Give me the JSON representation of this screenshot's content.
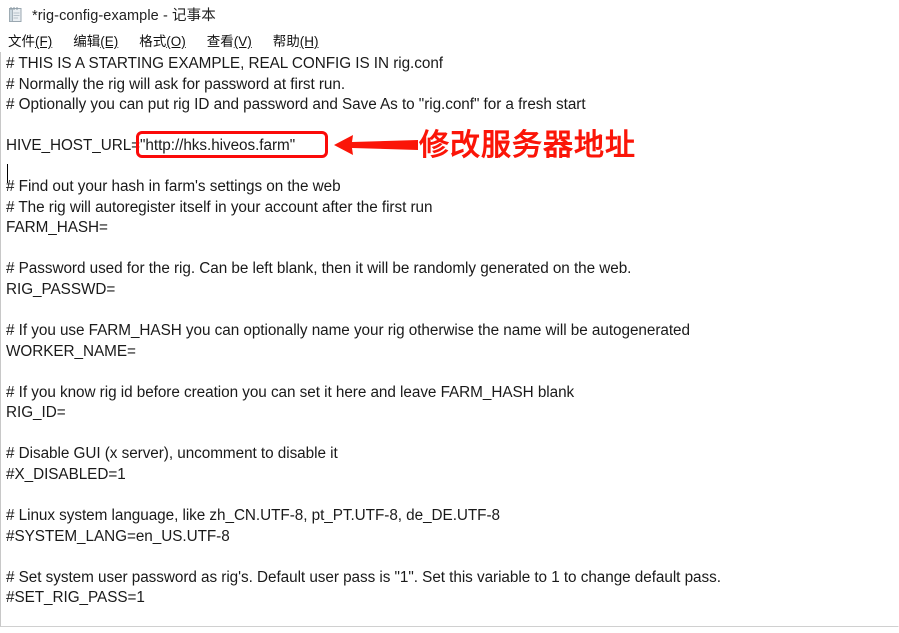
{
  "window": {
    "title": "*rig-config-example - 记事本",
    "icon": "notepad-icon"
  },
  "menubar": {
    "items": [
      {
        "label": "文件",
        "accel": "(F)",
        "name": "menu-file"
      },
      {
        "label": "编辑",
        "accel": "(E)",
        "name": "menu-edit"
      },
      {
        "label": "格式",
        "accel": "(O)",
        "name": "menu-format"
      },
      {
        "label": "查看",
        "accel": "(V)",
        "name": "menu-view"
      },
      {
        "label": "帮助",
        "accel": "(H)",
        "name": "menu-help"
      }
    ]
  },
  "editor": {
    "lines": [
      "# THIS IS A STARTING EXAMPLE, REAL CONFIG IS IN rig.conf",
      "# Normally the rig will ask for password at first run.",
      "# Optionally you can put rig ID and password and Save As to \"rig.conf\" for a fresh start",
      "",
      "HIVE_HOST_URL=\"http://hks.hiveos.farm\"",
      "",
      "# Find out your hash in farm's settings on the web",
      "# The rig will autoregister itself in your account after the first run",
      "FARM_HASH=",
      "",
      "# Password used for the rig. Can be left blank, then it will be randomly generated on the web.",
      "RIG_PASSWD=",
      "",
      "# If you use FARM_HASH you can optionally name your rig otherwise the name will be autogenerated",
      "WORKER_NAME=",
      "",
      "# If you know rig id before creation you can set it here and leave FARM_HASH blank",
      "RIG_ID=",
      "",
      "# Disable GUI (x server), uncomment to disable it",
      "#X_DISABLED=1",
      "",
      "# Linux system language, like zh_CN.UTF-8, pt_PT.UTF-8, de_DE.UTF-8",
      "#SYSTEM_LANG=en_US.UTF-8",
      "",
      "# Set system user password as rig's. Default user pass is \"1\". Set this variable to 1 to change default pass.",
      "#SET_RIG_PASS=1"
    ],
    "caret_line": 4,
    "highlighted_value": "\"http://hks.hiveos.farm\"",
    "highlighted_key": "HIVE_HOST_URL"
  },
  "annotation": {
    "text": "修改服务器地址",
    "arrow": "left-arrow-icon",
    "box": "highlight-box",
    "color": "#fb1508"
  }
}
